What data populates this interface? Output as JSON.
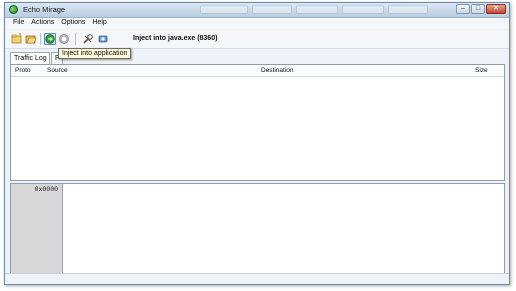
{
  "window": {
    "title": "Echo Mirage",
    "controls": {
      "minimize": "–",
      "maximize": "□",
      "close": "✕"
    }
  },
  "menu": [
    "File",
    "Actions",
    "Options",
    "Help"
  ],
  "toolbar": {
    "buttons": [
      {
        "name": "new-log-icon"
      },
      {
        "name": "open-log-icon"
      },
      {
        "name": "inject-application-icon",
        "pressed": true
      },
      {
        "name": "stop-icon"
      },
      {
        "name": "tools-icon"
      },
      {
        "name": "settings-icon"
      }
    ],
    "status": "Inject into java.exe (8360)"
  },
  "tooltip": "Inject into application",
  "tabs": [
    "Traffic Log",
    "F"
  ],
  "table": {
    "columns": [
      "Proto",
      "Source",
      "Destination",
      "Size"
    ]
  },
  "hex": {
    "offset": "0x0000"
  },
  "colors": {
    "title_gradient_top": "#dbe7f3",
    "title_gradient_bottom": "#b9cde2",
    "hex_gutter": "#d7d7d7",
    "tooltip_bg": "#fff9d8"
  }
}
